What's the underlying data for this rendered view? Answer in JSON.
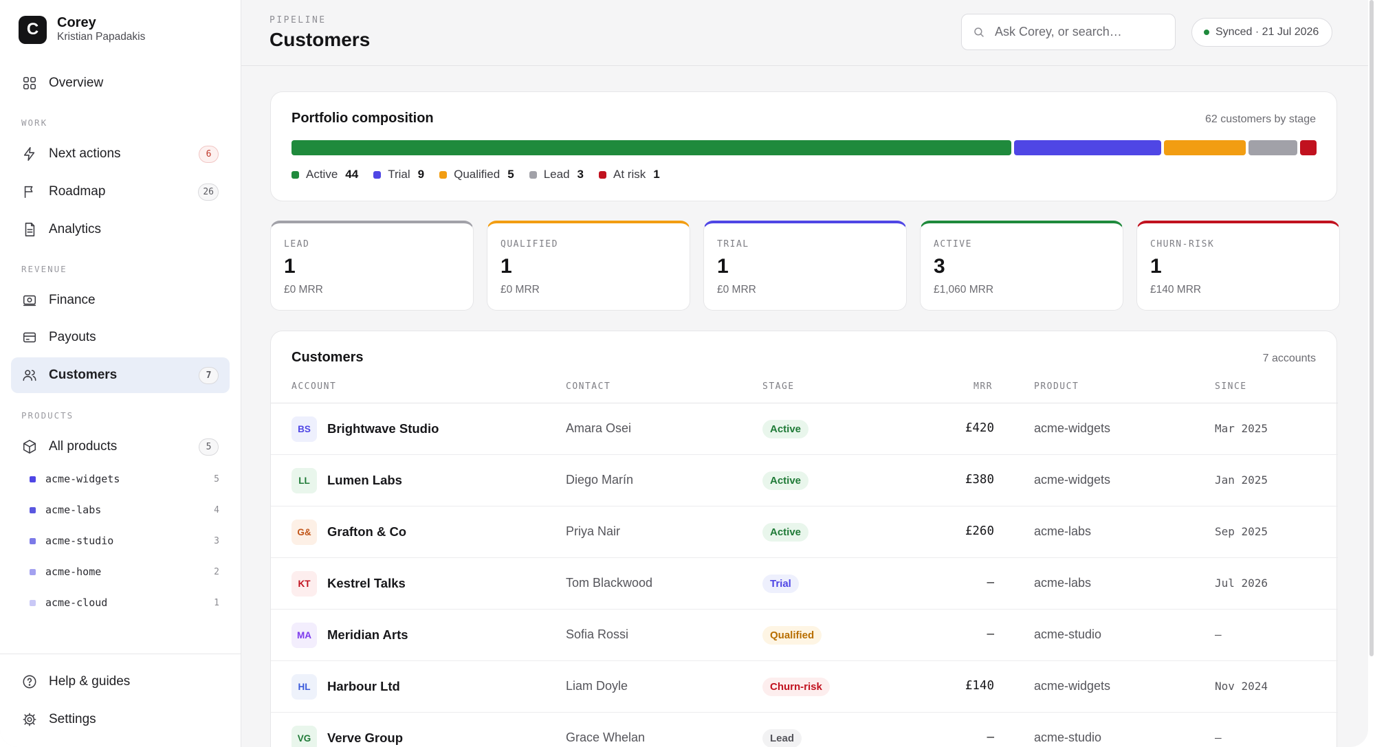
{
  "brand": {
    "initial": "C",
    "name": "Corey",
    "user": "Kristian Papadakis"
  },
  "sidebar": {
    "overview": {
      "label": "Overview"
    },
    "sections": {
      "work": "WORK",
      "revenue": "REVENUE",
      "products": "PRODUCTS"
    },
    "work_items": [
      {
        "label": "Next actions",
        "badge": "6",
        "icon": "lightning-icon"
      },
      {
        "label": "Roadmap",
        "badge": "26",
        "icon": "flag-icon"
      },
      {
        "label": "Analytics",
        "icon": "document-icon"
      }
    ],
    "revenue_items": [
      {
        "label": "Finance",
        "icon": "banknote-icon"
      },
      {
        "label": "Payouts",
        "icon": "card-icon"
      },
      {
        "label": "Customers",
        "badge": "7",
        "icon": "users-icon",
        "active": true
      }
    ],
    "all_products": {
      "label": "All products",
      "badge": "5",
      "icon": "box-icon"
    },
    "products": [
      {
        "name": "acme-widgets",
        "count": "5",
        "color": "#4f46e5"
      },
      {
        "name": "acme-labs",
        "count": "4",
        "color": "#5a57e0"
      },
      {
        "name": "acme-studio",
        "count": "3",
        "color": "#7c7ae8"
      },
      {
        "name": "acme-home",
        "count": "2",
        "color": "#a3a1f0"
      },
      {
        "name": "acme-cloud",
        "count": "1",
        "color": "#c9c8f6"
      }
    ],
    "footer": [
      {
        "label": "Help & guides",
        "icon": "help-icon"
      },
      {
        "label": "Settings",
        "icon": "gear-icon"
      }
    ]
  },
  "header": {
    "eyebrow": "PIPELINE",
    "title": "Customers",
    "search_placeholder": "Ask Corey, or search…",
    "sync_text": "Synced · 21 Jul 2026",
    "sync_color": "#1f8a3c"
  },
  "portfolio": {
    "title": "Portfolio composition",
    "meta": "62 customers by stage",
    "segments": [
      {
        "label": "Active",
        "count": 44,
        "color": "#1f8a3c"
      },
      {
        "label": "Trial",
        "count": 9,
        "color": "#4f46e5"
      },
      {
        "label": "Qualified",
        "count": 5,
        "color": "#f29d12"
      },
      {
        "label": "Lead",
        "count": 3,
        "color": "#a1a1a8"
      },
      {
        "label": "At risk",
        "count": 1,
        "color": "#c1121f"
      }
    ]
  },
  "stages": [
    {
      "label": "LEAD",
      "count": "1",
      "mrr": "£0 MRR",
      "color": "#a1a1a8"
    },
    {
      "label": "QUALIFIED",
      "count": "1",
      "mrr": "£0 MRR",
      "color": "#f29d12"
    },
    {
      "label": "TRIAL",
      "count": "1",
      "mrr": "£0 MRR",
      "color": "#4f46e5"
    },
    {
      "label": "ACTIVE",
      "count": "3",
      "mrr": "£1,060 MRR",
      "color": "#1f8a3c"
    },
    {
      "label": "CHURN-RISK",
      "count": "1",
      "mrr": "£140 MRR",
      "color": "#c1121f"
    }
  ],
  "customers": {
    "title": "Customers",
    "meta": "7 accounts",
    "columns": {
      "account": "ACCOUNT",
      "contact": "CONTACT",
      "stage": "STAGE",
      "mrr": "MRR",
      "product": "PRODUCT",
      "since": "SINCE"
    },
    "rows": [
      {
        "initials": "BS",
        "account": "Brightwave Studio",
        "contact": "Amara Osei",
        "stage": "Active",
        "mrr": "£420",
        "product": "acme-widgets",
        "since": "Mar 2025",
        "avatar_bg": "#eef0fd",
        "avatar_fg": "#4f46e5",
        "stage_bg": "#e9f6ec",
        "stage_fg": "#1f7a37"
      },
      {
        "initials": "LL",
        "account": "Lumen Labs",
        "contact": "Diego Marín",
        "stage": "Active",
        "mrr": "£380",
        "product": "acme-widgets",
        "since": "Jan 2025",
        "avatar_bg": "#e9f6ec",
        "avatar_fg": "#1f7a37",
        "stage_bg": "#e9f6ec",
        "stage_fg": "#1f7a37"
      },
      {
        "initials": "G&",
        "account": "Grafton & Co",
        "contact": "Priya Nair",
        "stage": "Active",
        "mrr": "£260",
        "product": "acme-labs",
        "since": "Sep 2025",
        "avatar_bg": "#fdf0e6",
        "avatar_fg": "#c2561a",
        "stage_bg": "#e9f6ec",
        "stage_fg": "#1f7a37"
      },
      {
        "initials": "KT",
        "account": "Kestrel Talks",
        "contact": "Tom Blackwood",
        "stage": "Trial",
        "mrr": "—",
        "product": "acme-labs",
        "since": "Jul 2026",
        "avatar_bg": "#fdeeee",
        "avatar_fg": "#c1121f",
        "stage_bg": "#eef0fd",
        "stage_fg": "#4f46e5"
      },
      {
        "initials": "MA",
        "account": "Meridian Arts",
        "contact": "Sofia Rossi",
        "stage": "Qualified",
        "mrr": "—",
        "product": "acme-studio",
        "since": "—",
        "avatar_bg": "#f3eefd",
        "avatar_fg": "#7c3aed",
        "stage_bg": "#fef5e4",
        "stage_fg": "#b86e00"
      },
      {
        "initials": "HL",
        "account": "Harbour Ltd",
        "contact": "Liam Doyle",
        "stage": "Churn-risk",
        "mrr": "£140",
        "product": "acme-widgets",
        "since": "Nov 2024",
        "avatar_bg": "#eef2fb",
        "avatar_fg": "#3b5bdb",
        "stage_bg": "#fdeeee",
        "stage_fg": "#c1121f"
      },
      {
        "initials": "VG",
        "account": "Verve Group",
        "contact": "Grace Whelan",
        "stage": "Lead",
        "mrr": "—",
        "product": "acme-studio",
        "since": "—",
        "avatar_bg": "#e9f6ec",
        "avatar_fg": "#1f7a37",
        "stage_bg": "#f2f2f3",
        "stage_fg": "#55555b"
      }
    ]
  }
}
